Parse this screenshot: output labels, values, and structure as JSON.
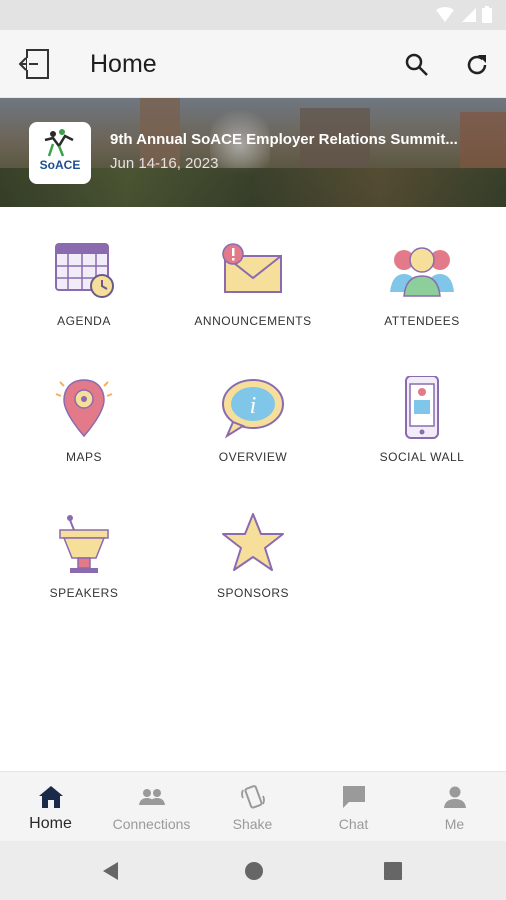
{
  "app": {
    "title": "Home"
  },
  "event": {
    "title": "9th Annual SoACE Employer Relations Summit...",
    "date": "Jun 14-16, 2023",
    "logo_text": "SoACE"
  },
  "tiles": [
    {
      "label": "AGENDA",
      "icon": "calendar-icon"
    },
    {
      "label": "ANNOUNCEMENTS",
      "icon": "envelope-alert-icon"
    },
    {
      "label": "ATTENDEES",
      "icon": "people-icon"
    },
    {
      "label": "MAPS",
      "icon": "map-pin-icon"
    },
    {
      "label": "OVERVIEW",
      "icon": "info-bubble-icon"
    },
    {
      "label": "SOCIAL WALL",
      "icon": "phone-icon"
    },
    {
      "label": "SPEAKERS",
      "icon": "podium-icon"
    },
    {
      "label": "SPONSORS",
      "icon": "star-icon"
    }
  ],
  "bottom_nav": [
    {
      "label": "Home",
      "icon": "home-icon",
      "active": true
    },
    {
      "label": "Connections",
      "icon": "people-icon",
      "active": false
    },
    {
      "label": "Shake",
      "icon": "shake-phone-icon",
      "active": false
    },
    {
      "label": "Chat",
      "icon": "chat-icon",
      "active": false
    },
    {
      "label": "Me",
      "icon": "person-icon",
      "active": false
    }
  ],
  "colors": {
    "accent_dark": "#1c2a4a",
    "icon_purple": "#8a6bb0",
    "icon_yellow": "#f6df9a",
    "icon_pink": "#e27a8a",
    "icon_blue": "#7fc6e8"
  }
}
